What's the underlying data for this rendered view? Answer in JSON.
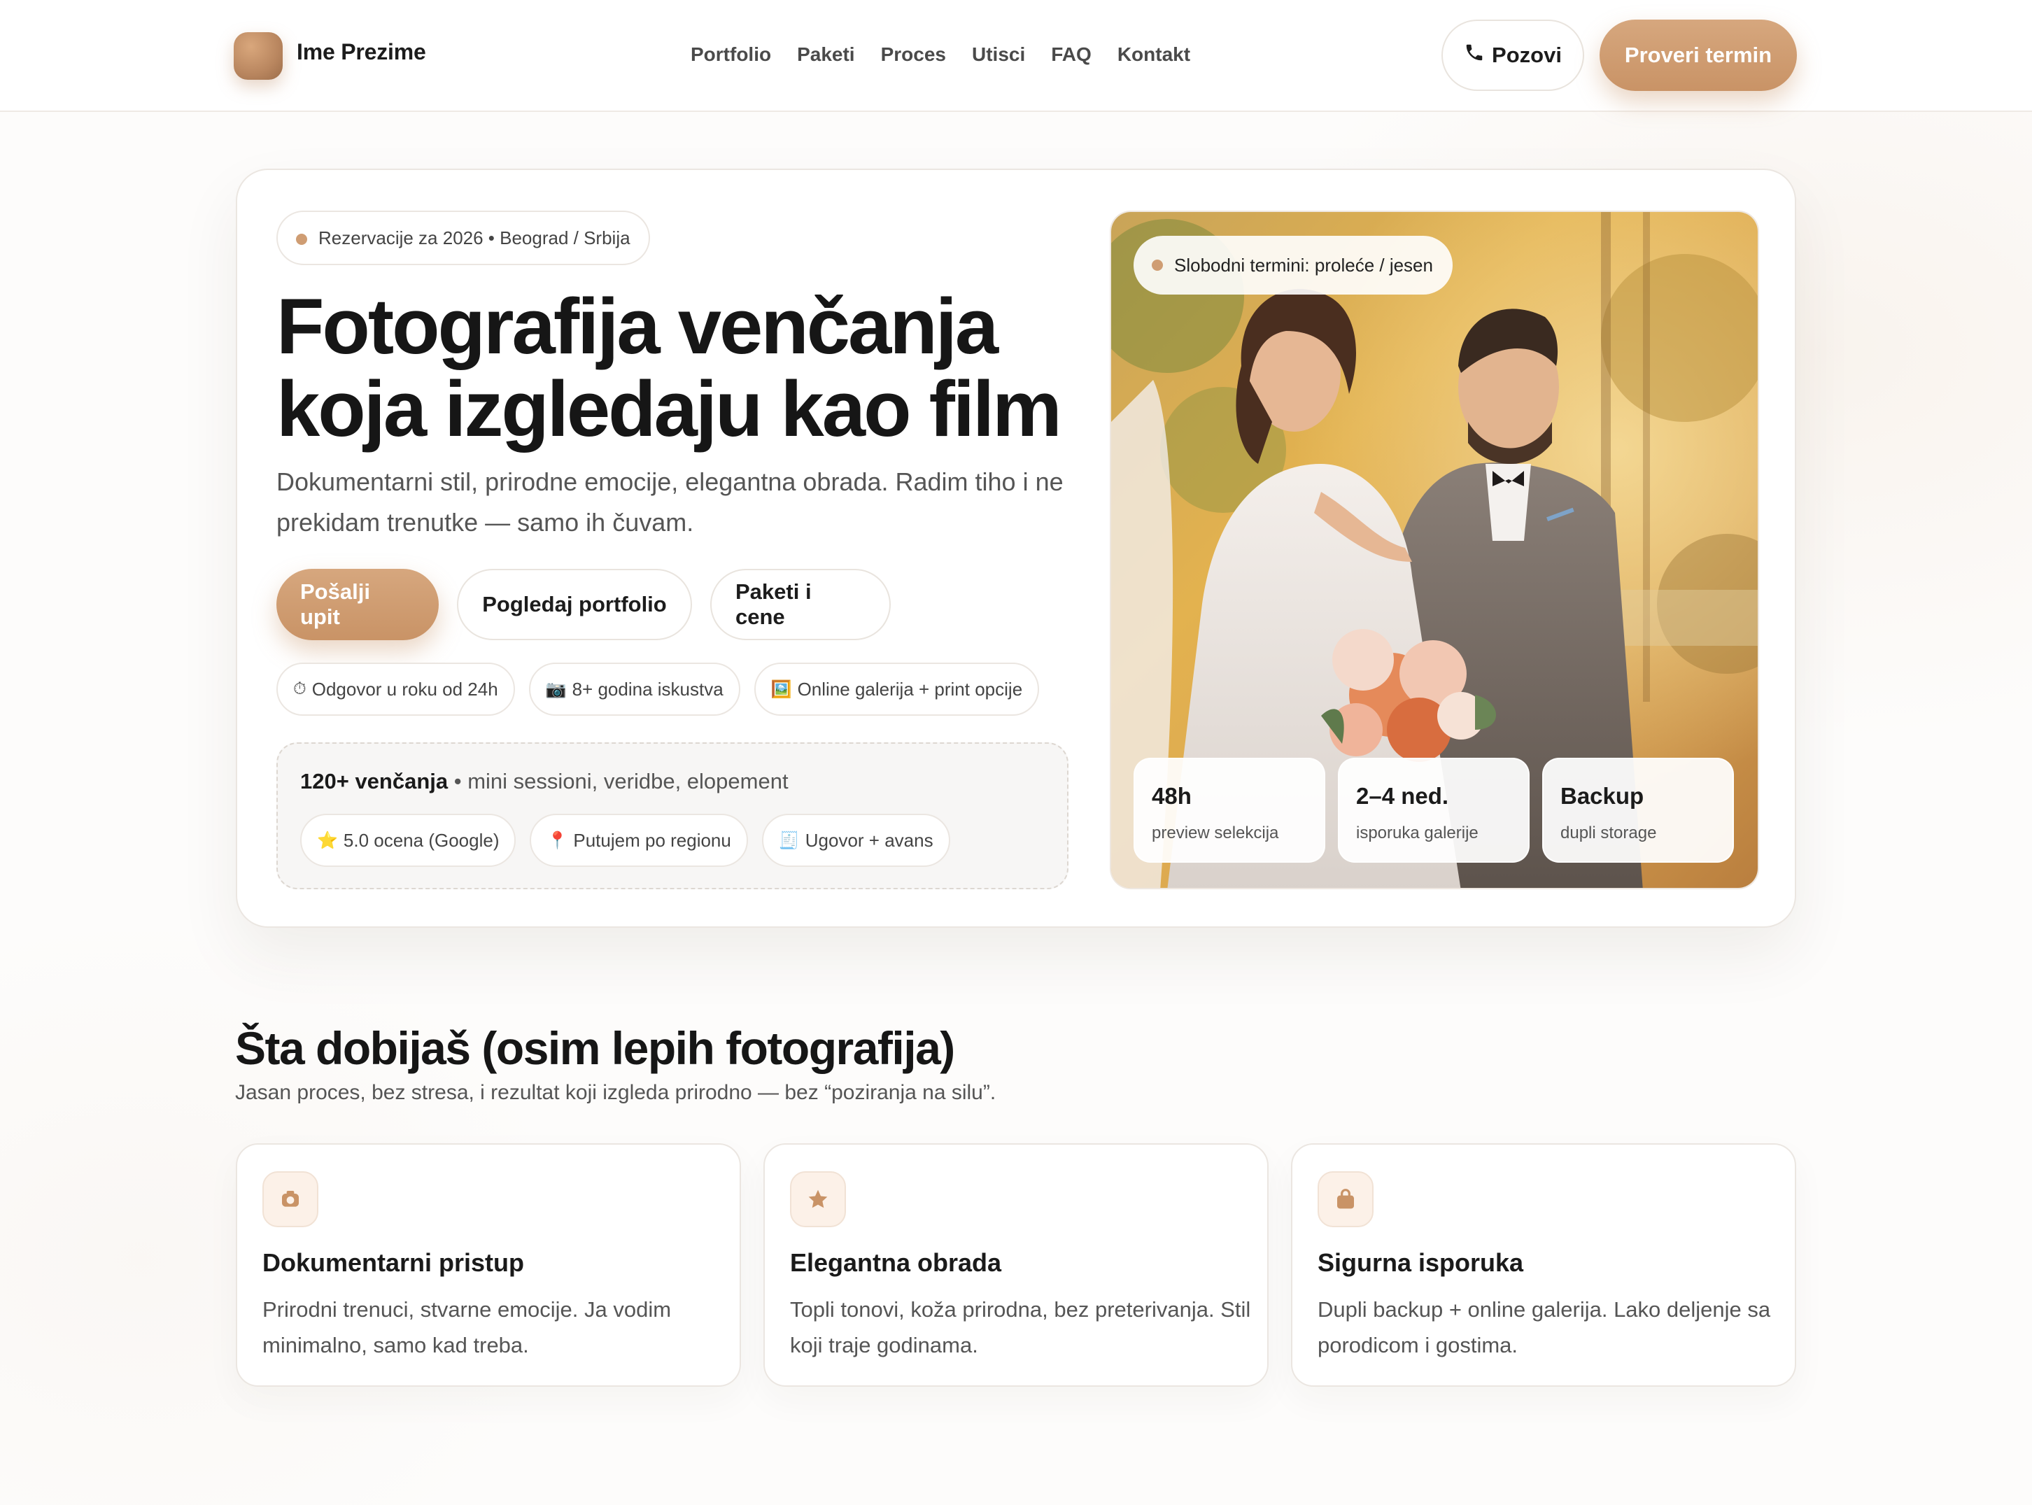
{
  "brand": {
    "name": "Ime Prezime",
    "accent": "#c99366"
  },
  "nav": {
    "items": [
      "Portfolio",
      "Paketi",
      "Proces",
      "Utisci",
      "FAQ",
      "Kontakt"
    ],
    "call_label": "Pozovi",
    "cta_label": "Proveri termin"
  },
  "hero": {
    "badge": "Rezervacije za 2026 • Beograd / Srbija",
    "title_line1": "Fotografija venčanja",
    "title_line2": "koja izgledaju kao film",
    "subtitle": "Dokumentarni stil, prirodne emocije, elegantna obrada. Radim tiho i ne prekidam trenutke — samo ih čuvam.",
    "buttons": {
      "primary": "Pošalji upit",
      "portfolio": "Pogledaj portfolio",
      "packages": "Paketi i cene"
    },
    "chips": [
      {
        "icon": "⏱",
        "text": "Odgovor u roku od 24h"
      },
      {
        "icon": "📷",
        "text": "8+ godina iskustva"
      },
      {
        "icon": "🖼️",
        "text": "Online galerija + print opcije"
      }
    ],
    "stats": {
      "headline_bold": "120+ venčanja",
      "headline_rest": " • mini sessioni, veridbe, elopement",
      "chips": [
        {
          "icon": "⭐",
          "text": "5.0 ocena (Google)"
        },
        {
          "icon": "📍",
          "text": "Putujem po regionu"
        },
        {
          "icon": "🧾",
          "text": "Ugovor + avans"
        }
      ]
    },
    "photo": {
      "badge": "Slobodni termini: proleće / jesen",
      "cards": [
        {
          "value": "48h",
          "label": "preview selekcija"
        },
        {
          "value": "2–4 ned.",
          "label": "isporuka galerije"
        },
        {
          "value": "Backup",
          "label": "dupli storage"
        }
      ]
    }
  },
  "features": {
    "title": "Šta dobijaš (osim lepih fotografija)",
    "subtitle": "Jasan proces, bez stresa, i rezultat koji izgleda prirodno — bez “poziranja na silu”.",
    "items": [
      {
        "icon": "camera-icon",
        "title": "Dokumentarni pristup",
        "text": "Prirodni trenuci, stvarne emocije. Ja vodim minimalno, samo kad treba."
      },
      {
        "icon": "star-icon",
        "title": "Elegantna obrada",
        "text": "Topli tonovi, koža prirodna, bez preterivanja. Stil koji traje godinama."
      },
      {
        "icon": "bag-icon",
        "title": "Sigurna isporuka",
        "text": "Dupli backup + online galerija. Lako deljenje sa porodicom i gostima."
      }
    ]
  }
}
